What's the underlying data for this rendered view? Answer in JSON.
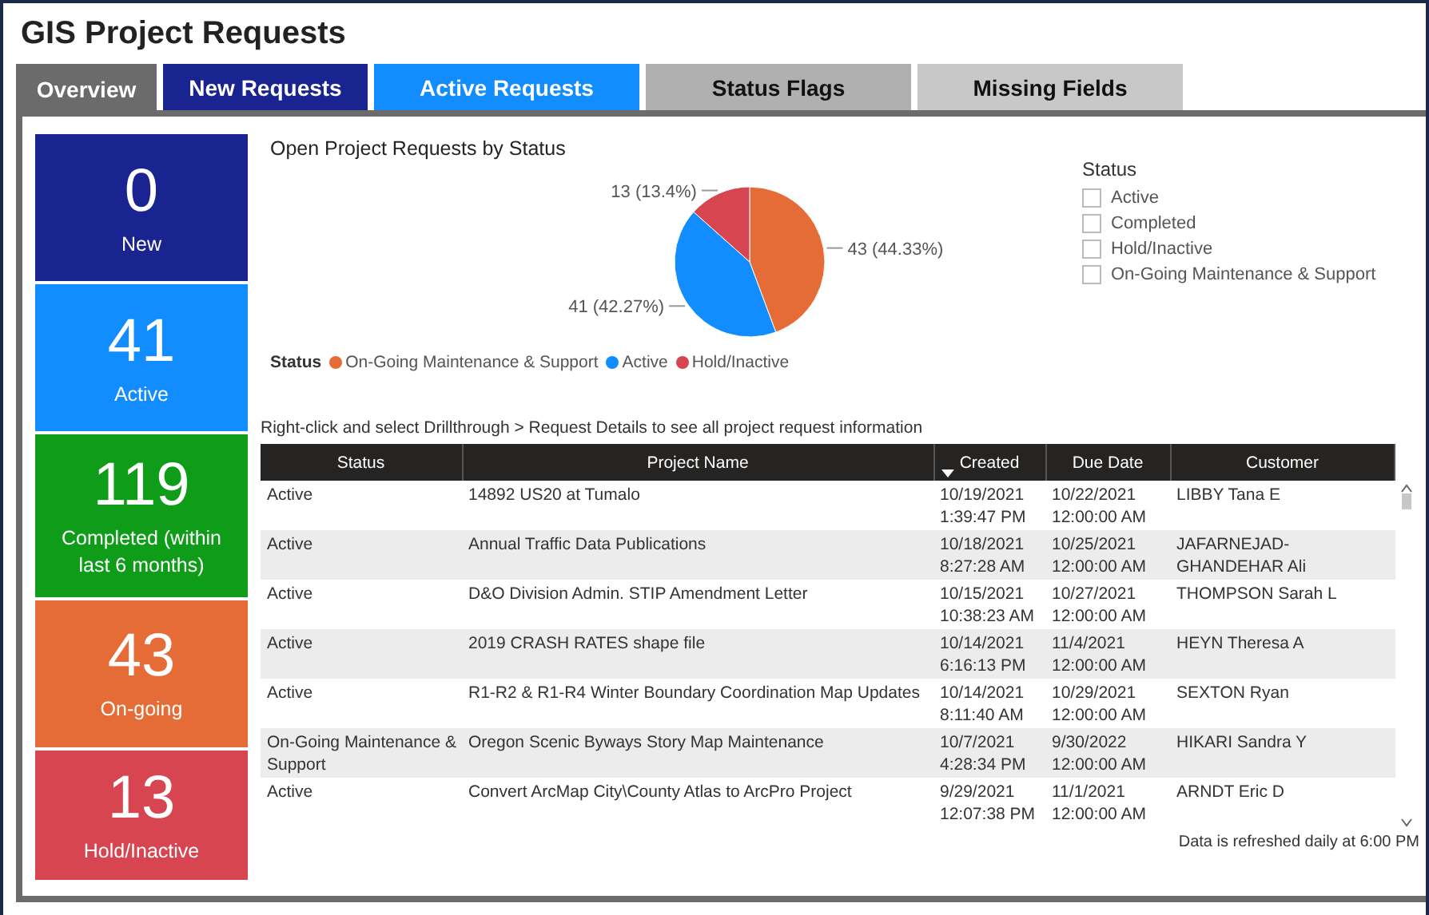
{
  "title": "GIS Project Requests",
  "tabs": [
    {
      "label": "Overview",
      "selected": true,
      "color": "#6b6b6b"
    },
    {
      "label": "New Requests",
      "selected": false,
      "color": "#1a2491"
    },
    {
      "label": "Active Requests",
      "selected": false,
      "color": "#118dff"
    },
    {
      "label": "Status Flags",
      "selected": false,
      "color": "#b0b0b0"
    },
    {
      "label": "Missing Fields",
      "selected": false,
      "color": "#c8c8c8"
    }
  ],
  "cards": [
    {
      "value": "0",
      "label": "New",
      "color": "#1a2491"
    },
    {
      "value": "41",
      "label": "Active",
      "color": "#118dff"
    },
    {
      "value": "119",
      "label": "Completed (within last 6 months)",
      "color": "#0f9d19"
    },
    {
      "value": "43",
      "label": "On-going",
      "color": "#e66c37"
    },
    {
      "value": "13",
      "label": "Hold/Inactive",
      "color": "#d64550"
    }
  ],
  "chart": {
    "legend_title": "Status",
    "chart_data": {
      "type": "pie",
      "title": "Open Project Requests by Status",
      "categories": [
        "On-Going Maintenance & Support",
        "Active",
        "Hold/Inactive"
      ],
      "colors": [
        "#e66c37",
        "#118dff",
        "#d64550"
      ],
      "values": [
        43,
        41,
        13
      ],
      "value_labels": [
        "43 (44.33%)",
        "41 (42.27%)",
        "13 (13.4%)"
      ]
    }
  },
  "slicer": {
    "title": "Status",
    "options": [
      {
        "label": "Active",
        "checked": false
      },
      {
        "label": "Completed",
        "checked": false
      },
      {
        "label": "Hold/Inactive",
        "checked": false
      },
      {
        "label": "On-Going Maintenance & Support",
        "checked": false
      }
    ]
  },
  "table": {
    "note": "Right-click and select Drillthrough > Request Details to see all project request information",
    "columns": [
      {
        "label": "Status",
        "sorted": false
      },
      {
        "label": "Project Name",
        "sorted": false
      },
      {
        "label": "Created",
        "sorted": true
      },
      {
        "label": "Due Date",
        "sorted": false
      },
      {
        "label": "Customer",
        "sorted": false
      }
    ],
    "rows": [
      [
        "Active",
        "14892 US20 at Tumalo",
        "10/19/2021 1:39:47 PM",
        "10/22/2021 12:00:00 AM",
        "LIBBY Tana E"
      ],
      [
        "Active",
        "Annual Traffic Data Publications",
        "10/18/2021 8:27:28 AM",
        "10/25/2021 12:00:00 AM",
        "JAFARNEJAD-GHANDEHAR Ali"
      ],
      [
        "Active",
        "D&O Division Admin. STIP Amendment Letter",
        "10/15/2021 10:38:23 AM",
        "10/27/2021 12:00:00 AM",
        "THOMPSON Sarah L"
      ],
      [
        "Active",
        "2019 CRASH RATES shape file",
        "10/14/2021 6:16:13 PM",
        "11/4/2021 12:00:00 AM",
        "HEYN Theresa A"
      ],
      [
        "Active",
        "R1-R2 & R1-R4 Winter Boundary Coordination Map Updates",
        "10/14/2021 8:11:40 AM",
        "10/29/2021 12:00:00 AM",
        "SEXTON Ryan"
      ],
      [
        "On-Going Maintenance & Support",
        "Oregon Scenic Byways Story Map Maintenance",
        "10/7/2021 4:28:34 PM",
        "9/30/2022 12:00:00 AM",
        "HIKARI Sandra Y"
      ],
      [
        "Active",
        "Convert ArcMap City\\County Atlas to ArcPro Project",
        "9/29/2021 12:07:38 PM",
        "11/1/2021 12:00:00 AM",
        "ARNDT Eric D"
      ]
    ],
    "footnote": "Data is refreshed daily at 6:00 PM"
  }
}
